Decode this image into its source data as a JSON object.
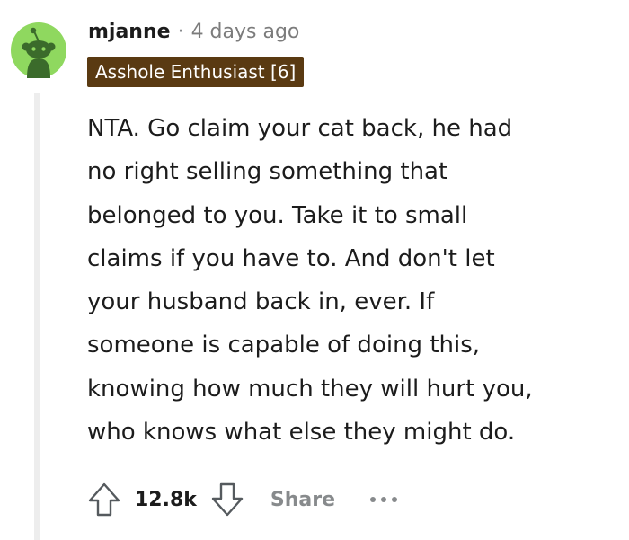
{
  "comment": {
    "avatar_icon": "snoo-avatar-icon",
    "username": "mjanne",
    "separator": "·",
    "timestamp": "4 days ago",
    "flair": "Asshole Enthusiast [6]",
    "body_lines": [
      "NTA. Go claim your cat back, he had",
      "no right selling something that",
      "belonged to you. Take it to small",
      "claims if you have to. And don't let",
      "your husband back in, ever. If",
      "someone is capable of doing this,",
      "knowing how much they will hurt you,",
      "who knows what else they might do."
    ],
    "score": "12.8k",
    "share_label": "Share",
    "upvote_icon": "upvote-arrow-icon",
    "downvote_icon": "downvote-arrow-icon",
    "more_icon": "more-options-icon"
  },
  "colors": {
    "avatar_green": "#8fd85f",
    "flair_bg": "#5a3a12",
    "flair_text": "#ffffff",
    "meta_grey": "#7c7c7c",
    "thread_line": "#ededed",
    "action_grey": "#878a8c"
  }
}
